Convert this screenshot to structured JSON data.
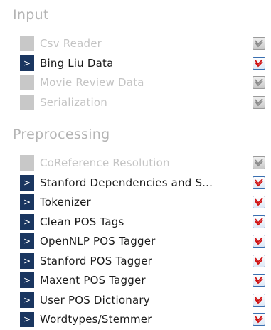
{
  "sections": [
    {
      "title": "Input",
      "items": [
        {
          "label": "Csv Reader",
          "enabled": false,
          "marker": ""
        },
        {
          "label": "Bing Liu Data",
          "enabled": true,
          "marker": ">"
        },
        {
          "label": "Movie Review Data",
          "enabled": false,
          "marker": ""
        },
        {
          "label": "Serialization",
          "enabled": false,
          "marker": ""
        }
      ]
    },
    {
      "title": "Preprocessing",
      "items": [
        {
          "label": "CoReference Resolution",
          "enabled": false,
          "marker": ""
        },
        {
          "label": "Stanford Dependencies and S...",
          "enabled": true,
          "marker": ">"
        },
        {
          "label": "Tokenizer",
          "enabled": true,
          "marker": ">"
        },
        {
          "label": "Clean POS Tags",
          "enabled": true,
          "marker": ">"
        },
        {
          "label": "OpenNLP POS Tagger",
          "enabled": true,
          "marker": ">"
        },
        {
          "label": "Stanford POS Tagger",
          "enabled": true,
          "marker": ">"
        },
        {
          "label": "Maxent POS Tagger",
          "enabled": true,
          "marker": ">"
        },
        {
          "label": "User POS Dictionary",
          "enabled": true,
          "marker": ">"
        },
        {
          "label": "Wordtypes/Stemmer",
          "enabled": true,
          "marker": ">"
        }
      ]
    }
  ],
  "colors": {
    "marker_enabled": "#1a3660",
    "marker_disabled": "#c8c8c8",
    "check_enabled": "#d01010",
    "check_disabled": "#8a8a8a"
  },
  "icons": {
    "checkbox": "checkbox-checked-icon"
  }
}
